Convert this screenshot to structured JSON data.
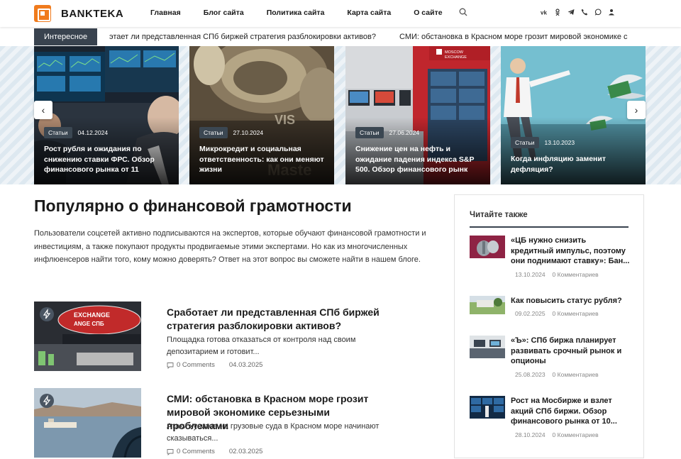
{
  "header": {
    "logo": "BANKTEKA",
    "nav": [
      "Главная",
      "Блог сайта",
      "Политика сайта",
      "Карта сайта",
      "О сайте"
    ],
    "socials": [
      "vk-icon",
      "odnoklassniki-icon",
      "telegram-icon",
      "phone-icon",
      "whatsapp-icon",
      "user-icon"
    ]
  },
  "ticker": {
    "label": "Интересное",
    "items": [
      "этает ли представленная СПб биржей стратегия разблокировки активов?",
      "СМИ: обстановка в Красном море грозит мировой экономике с"
    ]
  },
  "slider": {
    "prev": "‹",
    "next": "›",
    "slides": [
      {
        "badge": "Статьи",
        "date": "04.12.2024",
        "title": "Рост рубля и ожидания по снижению ставки ФРС. Обзор финансового рынка от 11"
      },
      {
        "badge": "Статьи",
        "date": "27.10.2024",
        "title": "Микрокредит и социальная ответственность: как они меняют жизни"
      },
      {
        "badge": "Статьи",
        "date": "27.06.2024",
        "title": "Снижение цен на нефть и ожидание падения индекса S&P 500. Обзор финансового рынк"
      },
      {
        "badge": "Статьи",
        "date": "13.10.2023",
        "title": "Когда инфляцию заменит дефляция?"
      }
    ]
  },
  "main": {
    "title": "Популярно о финансовой грамотности",
    "description": "Пользователи соцсетей активно подписываются на экспертов, которые обучают финансовой грамотности и инвестициям, а также покупают продукты продвигаемые этими экспертами. Но как из многочисленных инфлюенсеров найти того, кому можно доверять? Ответ на этот вопрос вы сможете найти в нашем блоге.",
    "posts": [
      {
        "title": "Сработает ли представленная СПб биржей стратегия разблокировки активов?",
        "excerpt": "Площадка готова отказаться от контроля над своим депозитарием и готовит...",
        "comments": "0 Comments",
        "date": "04.03.2025"
      },
      {
        "title": "СМИ: обстановка в Красном море грозит мировой экономике серьезными проблемами",
        "excerpt": "Атаки хуситов на грузовые суда в Красном море начинают сказываться...",
        "comments": "0 Comments",
        "date": "02.03.2025"
      }
    ]
  },
  "sidebar": {
    "heading": "Читайте также",
    "items": [
      {
        "title": "«ЦБ нужно снизить кредитный импульс, поэтому они поднимают ставку»: Бан...",
        "date": "13.10.2024",
        "comments": "0 Комментариев"
      },
      {
        "title": "Как повысить статус рубля?",
        "date": "09.02.2025",
        "comments": "0 Комментариев"
      },
      {
        "title": "«Ъ»: СПб биржа планирует развивать срочный рынок и опционы",
        "date": "25.08.2023",
        "comments": "0 Комментариев"
      },
      {
        "title": "Рост на Мосбирже и взлет акций СПб биржи. Обзор финансового рынка от 10...",
        "date": "28.10.2024",
        "comments": "0 Комментариев"
      }
    ]
  }
}
